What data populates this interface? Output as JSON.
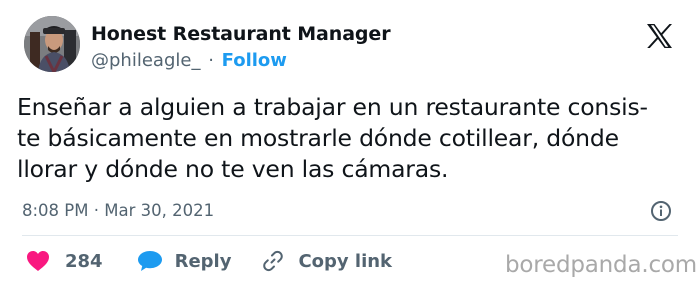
{
  "author": {
    "display_name": "Honest Restaurant Manager",
    "handle": "@phileagle_",
    "separator": "·",
    "follow_label": "Follow"
  },
  "tweet": {
    "lines": [
      "Enseñar a alguien a trabajar en un restaurante consis-",
      "te básicamente en mostrarle dónde cotillear, dónde",
      "llorar y dónde no te ven las cámaras."
    ],
    "timestamp": "8:08 PM · Mar 30, 2021"
  },
  "actions": {
    "like_count": "284",
    "reply_label": "Reply",
    "copy_link_label": "Copy link"
  },
  "icons": {
    "platform": "x-logo-icon",
    "info": "info-icon",
    "like": "heart-icon",
    "reply": "speech-bubble-icon",
    "copy": "link-icon"
  },
  "colors": {
    "text": "#0f1419",
    "secondary": "#536471",
    "follow": "#1d9bf0",
    "like": "#f91880",
    "reply": "#1d9bf0"
  },
  "watermark": "boredpanda.com"
}
